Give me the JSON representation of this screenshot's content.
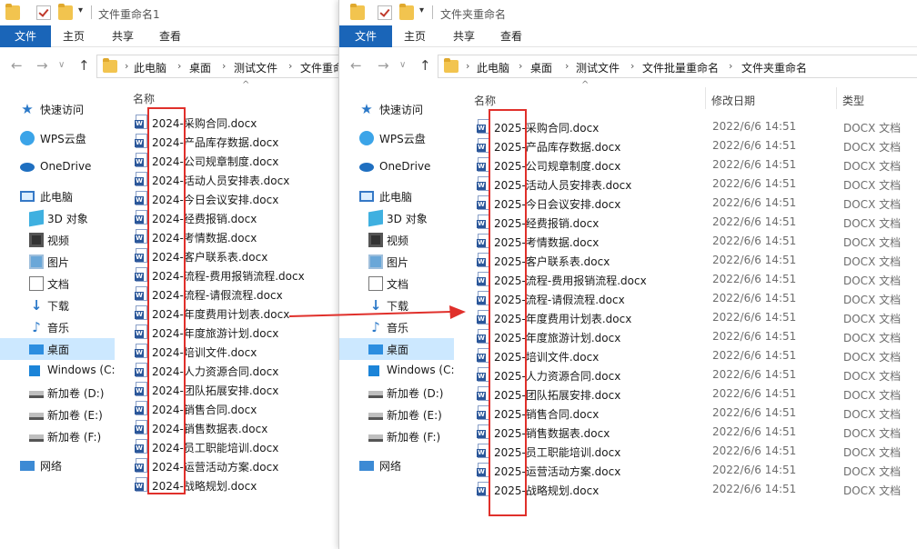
{
  "win1": {
    "title": "文件重命名1",
    "ribbon": [
      "文件",
      "主页",
      "共享",
      "查看"
    ],
    "breadcrumb": [
      "此电脑",
      "桌面",
      "测试文件",
      "文件重命"
    ],
    "column_name": "名称",
    "files": [
      "2024-采购合同.docx",
      "2024-产品库存数据.docx",
      "2024-公司规章制度.docx",
      "2024-活动人员安排表.docx",
      "2024-今日会议安排.docx",
      "2024-经费报销.docx",
      "2024-考情数据.docx",
      "2024-客户联系表.docx",
      "2024-流程-费用报销流程.docx",
      "2024-流程-请假流程.docx",
      "2024-年度费用计划表.docx",
      "2024-年度旅游计划.docx",
      "2024-培训文件.docx",
      "2024-人力资源合同.docx",
      "2024-团队拓展安排.docx",
      "2024-销售合同.docx",
      "2024-销售数据表.docx",
      "2024-员工职能培训.docx",
      "2024-运营活动方案.docx",
      "2024-战略规划.docx"
    ]
  },
  "win2": {
    "title": "文件夹重命名",
    "ribbon": [
      "文件",
      "主页",
      "共享",
      "查看"
    ],
    "breadcrumb": [
      "此电脑",
      "桌面",
      "测试文件",
      "文件批量重命名",
      "文件夹重命名"
    ],
    "columns": {
      "name": "名称",
      "date": "修改日期",
      "type": "类型"
    },
    "file_date": "2022/6/6 14:51",
    "file_type": "DOCX 文档",
    "files": [
      "2025-采购合同.docx",
      "2025-产品库存数据.docx",
      "2025-公司规章制度.docx",
      "2025-活动人员安排表.docx",
      "2025-今日会议安排.docx",
      "2025-经费报销.docx",
      "2025-考情数据.docx",
      "2025-客户联系表.docx",
      "2025-流程-费用报销流程.docx",
      "2025-流程-请假流程.docx",
      "2025-年度费用计划表.docx",
      "2025-年度旅游计划.docx",
      "2025-培训文件.docx",
      "2025-人力资源合同.docx",
      "2025-团队拓展安排.docx",
      "2025-销售合同.docx",
      "2025-销售数据表.docx",
      "2025-员工职能培训.docx",
      "2025-运营活动方案.docx",
      "2025-战略规划.docx"
    ]
  },
  "sidebar": [
    {
      "label": "快速访问",
      "icon": "star-icon"
    },
    {
      "label": "WPS云盘",
      "icon": "wps-cloud-icon"
    },
    {
      "label": "OneDrive",
      "icon": "onedrive-icon"
    },
    {
      "label": "此电脑",
      "icon": "computer-icon"
    },
    {
      "label": "3D 对象",
      "icon": "3d-objects-icon"
    },
    {
      "label": "视频",
      "icon": "video-icon"
    },
    {
      "label": "图片",
      "icon": "pictures-icon"
    },
    {
      "label": "文档",
      "icon": "documents-icon"
    },
    {
      "label": "下载",
      "icon": "download-icon"
    },
    {
      "label": "音乐",
      "icon": "music-icon"
    },
    {
      "label": "桌面",
      "icon": "desktop-icon",
      "selected": true
    },
    {
      "label": "Windows (C:",
      "icon": "windows-drive-icon"
    },
    {
      "label": "新加卷 (D:)",
      "icon": "drive-icon"
    },
    {
      "label": "新加卷 (E:)",
      "icon": "drive-icon"
    },
    {
      "label": "新加卷 (F:)",
      "icon": "drive-icon"
    },
    {
      "label": "网络",
      "icon": "network-icon"
    }
  ],
  "colors": {
    "accent": "#1a65b8",
    "highlight_box": "#e0302b",
    "selection": "#cce8ff"
  }
}
